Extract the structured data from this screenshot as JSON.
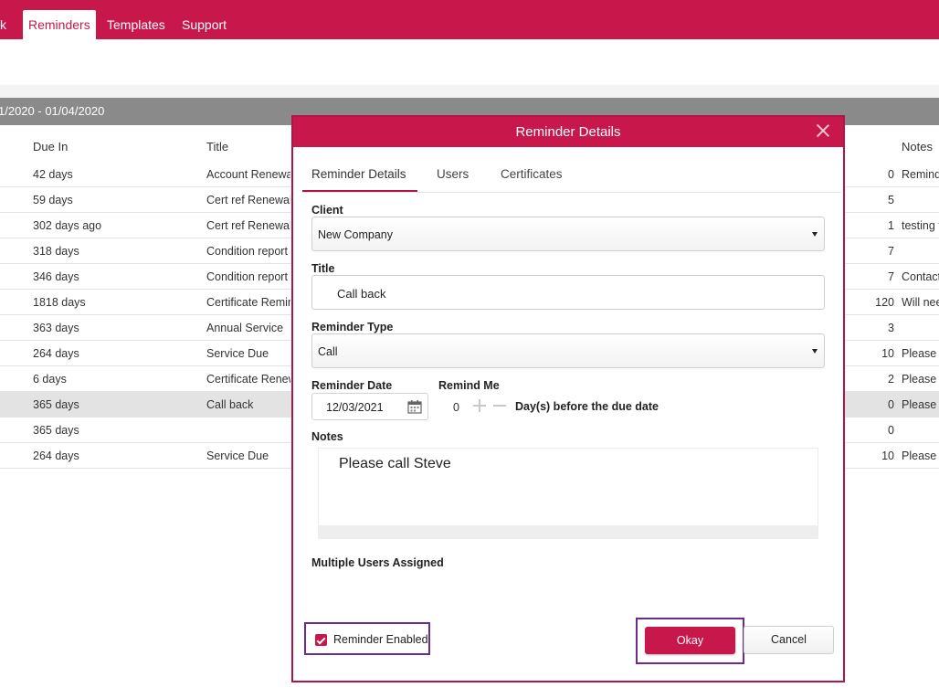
{
  "nav": {
    "tabs": [
      {
        "label": "k"
      },
      {
        "label": "Reminders"
      },
      {
        "label": "Templates"
      },
      {
        "label": "Support"
      }
    ]
  },
  "date_range": "1/2020 - 01/04/2020",
  "grid": {
    "headers": {
      "due_in": "Due In",
      "title": "Title",
      "notes": "Notes"
    },
    "rows": [
      {
        "due": "42 days",
        "title": "Account Renewal",
        "num": "0",
        "notes": "Remind"
      },
      {
        "due": "59 days",
        "title": "Cert ref Renewal",
        "num": "5",
        "notes": ""
      },
      {
        "due": "302 days ago",
        "title": "Cert ref Renewal",
        "num": "1",
        "notes": "testing t"
      },
      {
        "due": "318 days",
        "title": "Condition report c",
        "num": "7",
        "notes": ""
      },
      {
        "due": "346 days",
        "title": "Condition report c",
        "num": "7",
        "notes": "Contact"
      },
      {
        "due": "1818 days",
        "title": "Certificate Remind",
        "num": "120",
        "notes": "Will nee"
      },
      {
        "due": "363 days",
        "title": "Annual Service",
        "num": "3",
        "notes": ""
      },
      {
        "due": "264 days",
        "title": "Service Due",
        "num": "10",
        "notes": "Please c"
      },
      {
        "due": "6 days",
        "title": "Certificate Renew",
        "num": "2",
        "notes": "Please c"
      },
      {
        "due": "365 days",
        "title": "Call back",
        "num": "0",
        "notes": "Please c",
        "selected": true
      },
      {
        "due": "365 days",
        "title": "",
        "num": "0",
        "notes": ""
      },
      {
        "due": "264 days",
        "title": "Service Due",
        "num": "10",
        "notes": "Please c"
      }
    ]
  },
  "modal": {
    "title": "Reminder Details",
    "tabs": [
      {
        "label": "Reminder Details"
      },
      {
        "label": "Users"
      },
      {
        "label": "Certificates"
      }
    ],
    "client_label": "Client",
    "client_value": "New Company",
    "title_label": "Title",
    "title_value": "Call back",
    "type_label": "Reminder Type",
    "type_value": "Call",
    "date_label": "Reminder Date",
    "date_value": "12/03/2021",
    "remind_label": "Remind Me",
    "remind_value": "0",
    "remind_suffix": "Day(s) before the due date",
    "notes_label": "Notes",
    "notes_value": "Please call Steve",
    "users_label": "Multiple Users Assigned",
    "enabled_label": "Reminder Enabled",
    "enabled": true,
    "okay_label": "Okay",
    "cancel_label": "Cancel"
  },
  "colors": {
    "accent": "#c8174a",
    "highlight_outline": "#6a2c8f"
  },
  "icons": [
    "close-icon",
    "dropdown-caret-icon",
    "calendar-icon",
    "plus-icon",
    "minus-icon",
    "checkmark-icon"
  ]
}
